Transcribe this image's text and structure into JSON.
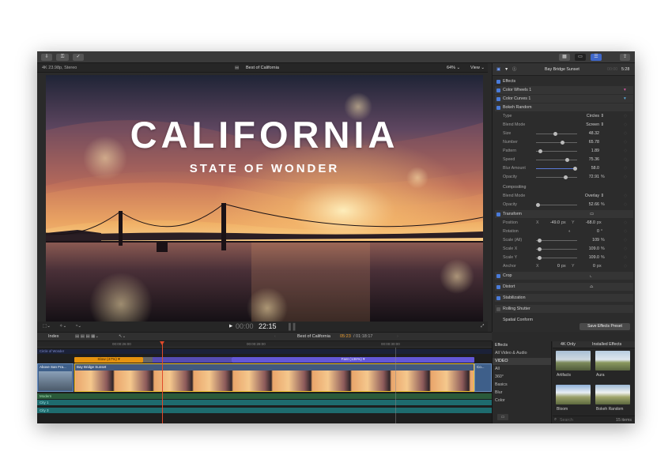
{
  "viewer": {
    "format": "4K 23.98p, Stereo",
    "project": "Best of California",
    "zoom": "64%",
    "view_menu": "View",
    "title_main": "CALIFORNIA",
    "title_sub": "STATE OF WONDER",
    "timecode_dim": "00:00",
    "timecode": "22:15"
  },
  "inspector": {
    "clip_name": "Bay Bridge Sunset",
    "duration": "5:28",
    "effects_heading": "Effects",
    "effects": [
      "Color Wheels 1",
      "Color Curves 1",
      "Bokeh Random"
    ],
    "params": [
      {
        "label": "Type",
        "value": "Circles",
        "menu": true
      },
      {
        "label": "Blend Mode",
        "value": "Screen",
        "menu": true
      },
      {
        "label": "Size",
        "value": "48.32",
        "level": 0.48
      },
      {
        "label": "Number",
        "value": "65.78",
        "level": 0.65
      },
      {
        "label": "Pattern",
        "value": "1.89",
        "level": 0.1
      },
      {
        "label": "Speed",
        "value": "75.36",
        "level": 0.75
      },
      {
        "label": "Blur Amount",
        "value": "58.0",
        "level": 0.95,
        "filled": true
      },
      {
        "label": "Opacity",
        "value": "72.91",
        "unit": "%",
        "level": 0.73
      }
    ],
    "compositing_heading": "Compositing",
    "comp_params": [
      {
        "label": "Blend Mode",
        "value": "Overlay",
        "menu": true
      },
      {
        "label": "Opacity",
        "value": "52.66",
        "unit": "%",
        "level": 0.05
      }
    ],
    "transform_heading": "Transform",
    "transform": [
      {
        "label": "Position",
        "x": "-49.0",
        "y": "-68.0",
        "unit": "px"
      },
      {
        "label": "Rotation",
        "value": "0",
        "unit": "°"
      },
      {
        "label": "Scale (All)",
        "value": "109",
        "unit": "%"
      },
      {
        "label": "Scale X",
        "value": "109.0",
        "unit": "%"
      },
      {
        "label": "Scale Y",
        "value": "109.0",
        "unit": "%"
      },
      {
        "label": "Anchor",
        "x": "0",
        "y": "0",
        "unit": "px"
      }
    ],
    "sections": [
      "Crop",
      "Distort",
      "Stabilization",
      "Rolling Shutter",
      "Spatial Conform"
    ],
    "save_button": "Save Effects Preset"
  },
  "timeline_bar": {
    "index": "Index",
    "project": "Best of California",
    "position": "05:23",
    "duration": "/ 01:18:17"
  },
  "timeline": {
    "ruler": [
      "00:00:26:00",
      "00:00:28:00",
      "00:00:30:00"
    ],
    "retime_slow": "Slow (47%) ▾",
    "retime_fast": "Fast (138%) ▾",
    "clip_left": "Above San Fra...",
    "clip_main": "Bay Bridge Sunset",
    "clip_right": "Co...",
    "top_label": "Circle of Wonder",
    "audio_tracks": [
      "Modern",
      "City 1",
      "City 3"
    ]
  },
  "browser": {
    "heading": "Effects",
    "categories": [
      "All Video & Audio",
      "VIDEO",
      "All",
      "360°",
      "Basics",
      "Blur",
      "Color"
    ],
    "filter_4k": "4K Only",
    "filter_installed": "Installed Effects",
    "thumbs": [
      "Artifacts",
      "Aura",
      "Bloom",
      "Bokeh Random"
    ],
    "search_placeholder": "Search",
    "count": "15 items"
  },
  "colors": {
    "accent": "#4a7bd9",
    "timecode_orange": "#f0a030",
    "retime_slow": "#e6930f",
    "retime_fast": "#6457d8",
    "playhead": "#e04a2a"
  }
}
